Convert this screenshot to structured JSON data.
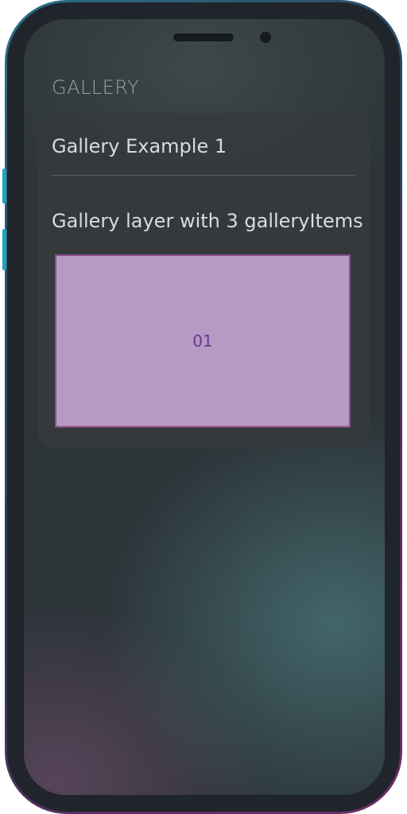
{
  "section": {
    "header": "GALLERY"
  },
  "card": {
    "title": "Gallery Example 1",
    "subtitle": "Gallery layer with 3 galleryItems"
  },
  "gallery": {
    "current_index": 1,
    "total_items": 3,
    "items": [
      {
        "label": "01"
      }
    ]
  },
  "colors": {
    "gallery_item_bg": "#b69ac4",
    "gallery_item_border": "#8a4f8a",
    "gallery_item_text": "#6a3a8a",
    "side_button": "#1fa3c4"
  }
}
